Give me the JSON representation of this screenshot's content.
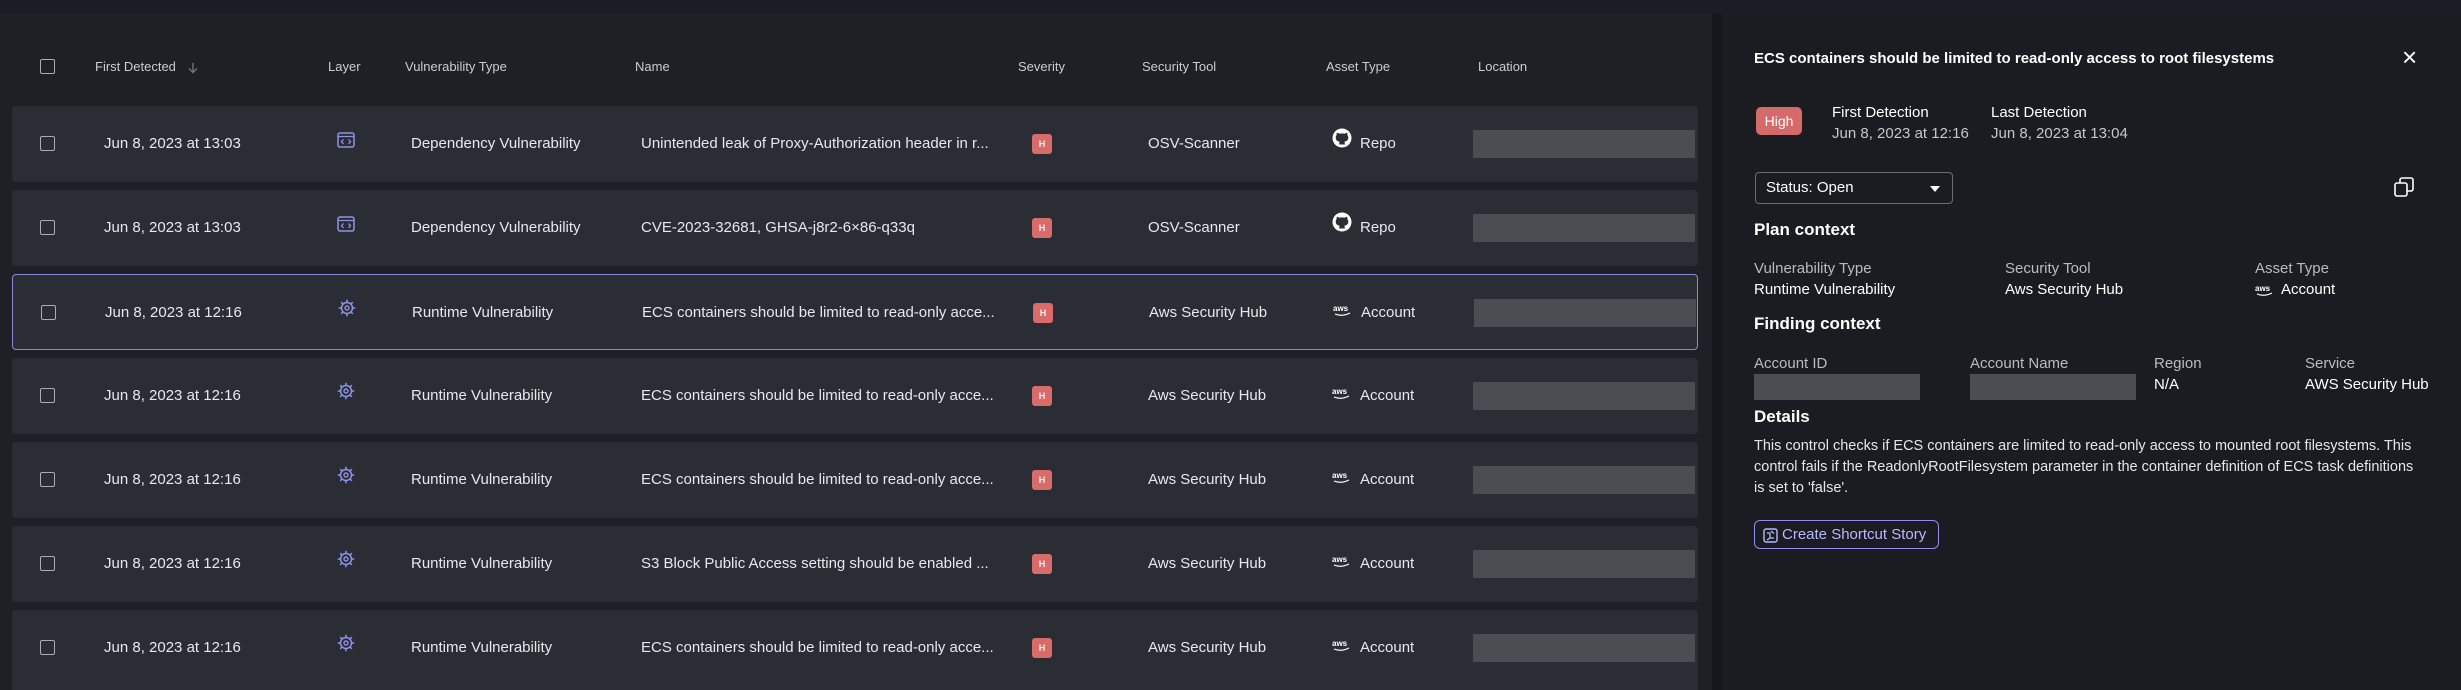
{
  "table": {
    "headers": {
      "first_detected": "First Detected",
      "layer": "Layer",
      "vulnerability_type": "Vulnerability Type",
      "name": "Name",
      "severity": "Severity",
      "security_tool": "Security Tool",
      "asset_type": "Asset Type",
      "location": "Location"
    },
    "rows": [
      {
        "date": "Jun 8, 2023 at 13:03",
        "layer_icon": "code-icon",
        "vuln_type": "Dependency Vulnerability",
        "name": "Unintended leak of Proxy-Authorization header in r...",
        "severity": "H",
        "tool": "OSV-Scanner",
        "asset_icon": "github-icon",
        "asset": "Repo",
        "selected": false
      },
      {
        "date": "Jun 8, 2023 at 13:03",
        "layer_icon": "code-icon",
        "vuln_type": "Dependency Vulnerability",
        "name": "CVE-2023-32681, GHSA-j8r2-6×86-q33q",
        "severity": "H",
        "tool": "OSV-Scanner",
        "asset_icon": "github-icon",
        "asset": "Repo",
        "selected": false
      },
      {
        "date": "Jun 8, 2023 at 12:16",
        "layer_icon": "gear-icon",
        "vuln_type": "Runtime Vulnerability",
        "name": "ECS containers should be limited to read-only acce...",
        "severity": "H",
        "tool": "Aws Security Hub",
        "asset_icon": "aws-icon",
        "asset": "Account",
        "selected": true
      },
      {
        "date": "Jun 8, 2023 at 12:16",
        "layer_icon": "gear-icon",
        "vuln_type": "Runtime Vulnerability",
        "name": "ECS containers should be limited to read-only acce...",
        "severity": "H",
        "tool": "Aws Security Hub",
        "asset_icon": "aws-icon",
        "asset": "Account",
        "selected": false
      },
      {
        "date": "Jun 8, 2023 at 12:16",
        "layer_icon": "gear-icon",
        "vuln_type": "Runtime Vulnerability",
        "name": "ECS containers should be limited to read-only acce...",
        "severity": "H",
        "tool": "Aws Security Hub",
        "asset_icon": "aws-icon",
        "asset": "Account",
        "selected": false
      },
      {
        "date": "Jun 8, 2023 at 12:16",
        "layer_icon": "gear-icon",
        "vuln_type": "Runtime Vulnerability",
        "name": "S3 Block Public Access setting should be enabled ...",
        "severity": "H",
        "tool": "Aws Security Hub",
        "asset_icon": "aws-icon",
        "asset": "Account",
        "selected": false
      },
      {
        "date": "Jun 8, 2023 at 12:16",
        "layer_icon": "gear-icon",
        "vuln_type": "Runtime Vulnerability",
        "name": "ECS containers should be limited to read-only acce...",
        "severity": "H",
        "tool": "Aws Security Hub",
        "asset_icon": "aws-icon",
        "asset": "Account",
        "selected": false
      }
    ]
  },
  "panel": {
    "title": "ECS containers should be limited to read-only access to root filesystems",
    "close_icon": "×",
    "severity": "High",
    "first_detection_label": "First Detection",
    "first_detection_value": "Jun 8, 2023 at 12:16",
    "last_detection_label": "Last Detection",
    "last_detection_value": "Jun 8, 2023 at 13:04",
    "status": "Status: Open",
    "plan_context": {
      "title": "Plan context",
      "vulnerability_type_label": "Vulnerability Type",
      "vulnerability_type_value": "Runtime Vulnerability",
      "security_tool_label": "Security Tool",
      "security_tool_value": "Aws Security Hub",
      "asset_type_label": "Asset Type",
      "asset_type_value": "Account"
    },
    "finding_context": {
      "title": "Finding context",
      "account_id_label": "Account ID",
      "account_name_label": "Account Name",
      "region_label": "Region",
      "region_value": "N/A",
      "service_label": "Service",
      "service_value": "AWS Security Hub"
    },
    "details": {
      "title": "Details",
      "text": "This control checks if ECS containers are limited to read-only access to mounted root filesystems. This control fails if the ReadonlyRootFilesystem parameter in the container definition of ECS task definitions is set to 'false'."
    },
    "shortcut_button": "Create Shortcut Story"
  },
  "colors": {
    "severity_high": "#d96b6b",
    "accent": "#8d8ef0",
    "selected_border": "#8a88d8",
    "layer_icon": "#8f93e8"
  }
}
